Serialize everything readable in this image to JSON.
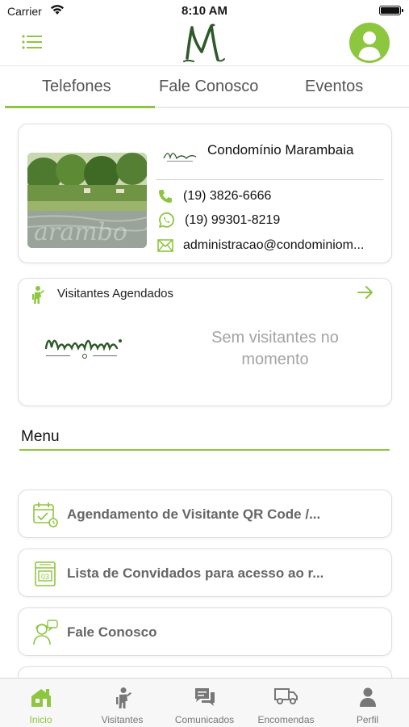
{
  "status": {
    "carrier": "Carrier",
    "time": "8:10 AM"
  },
  "tabs": [
    {
      "label": "Telefones",
      "active": true
    },
    {
      "label": "Fale Conosco",
      "active": false
    },
    {
      "label": "Eventos",
      "active": false
    }
  ],
  "contact": {
    "name": "Condomínio Marambaia",
    "phone": "(19) 3826-6666",
    "whatsapp": "(19) 99301-8219",
    "email": "administracao@condominiom..."
  },
  "visitors": {
    "title": "Visitantes Agendados",
    "empty_text": "Sem visitantes no momento"
  },
  "menu": {
    "title": "Menu",
    "items": [
      {
        "label": "Agendamento de Visitante QR Code /...",
        "icon": "calendar-check-icon"
      },
      {
        "label": "Lista de Convidados para acesso ao r...",
        "icon": "calendar-03-icon"
      },
      {
        "label": "Fale Conosco",
        "icon": "support-agent-icon"
      }
    ]
  },
  "tabbar": [
    {
      "label": "Inicio",
      "icon": "home-icon",
      "active": true
    },
    {
      "label": "Visitantes",
      "icon": "visitor-icon",
      "active": false
    },
    {
      "label": "Comunicados",
      "icon": "chat-icon",
      "active": false
    },
    {
      "label": "Encomendas",
      "icon": "truck-icon",
      "active": false
    },
    {
      "label": "Perfil",
      "icon": "user-icon",
      "active": false
    }
  ],
  "colors": {
    "accent": "#8dc63f",
    "logo_green": "#2e5a2a",
    "muted_text": "#a4a4a4"
  }
}
